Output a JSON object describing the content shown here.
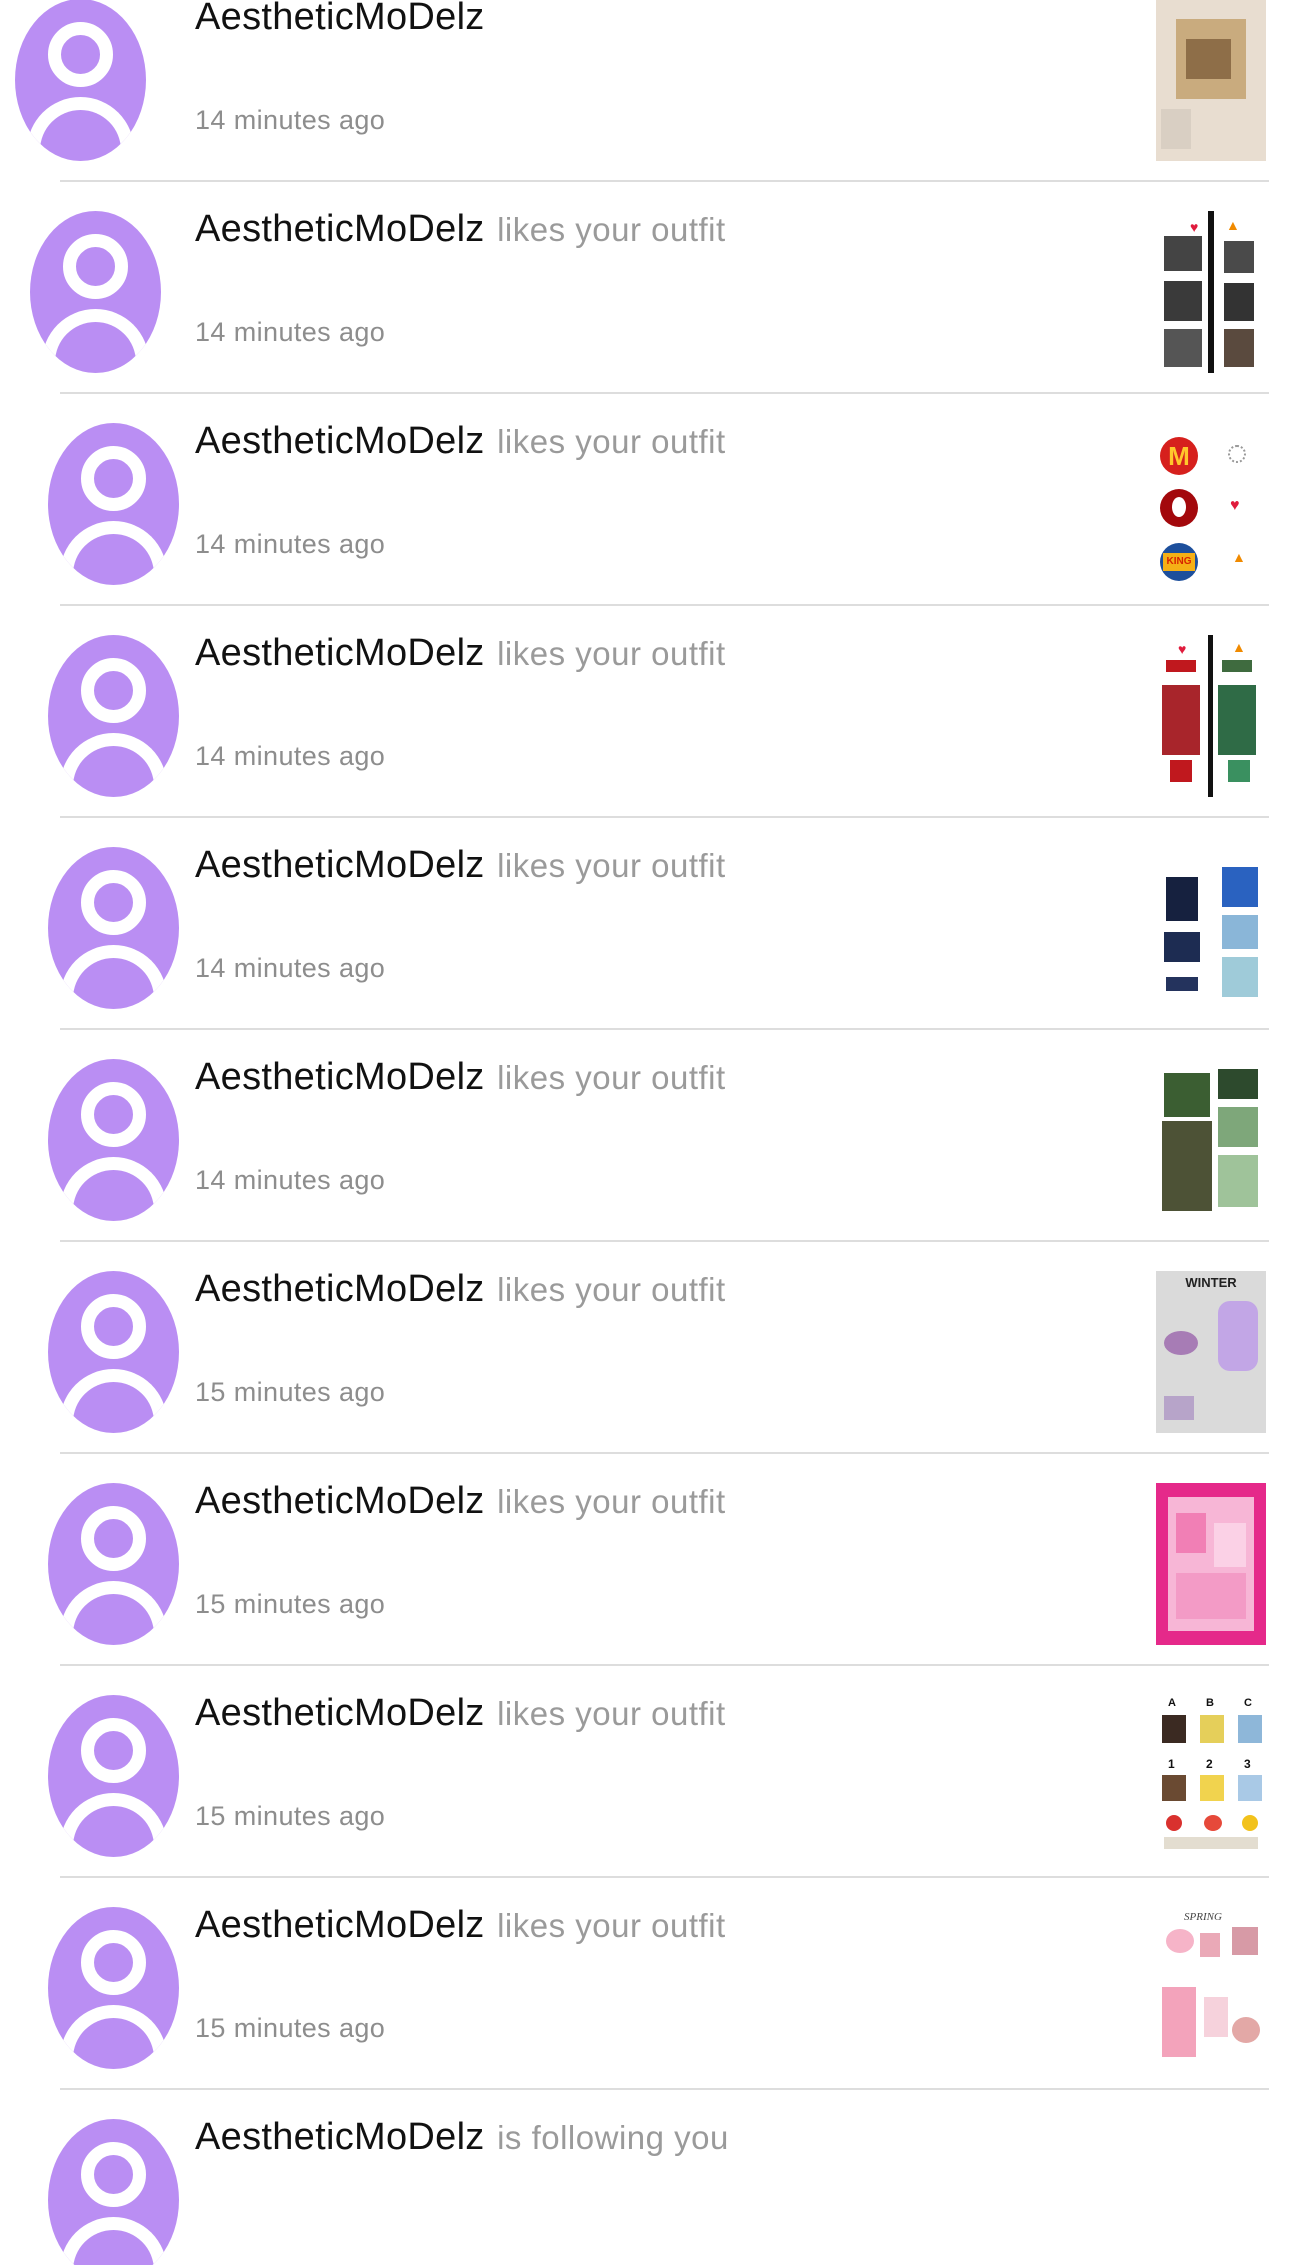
{
  "notifications": [
    {
      "user": "AestheticMoDelz",
      "action": "",
      "time": "14 minutes ago",
      "thumb": "collage-beige"
    },
    {
      "user": "AestheticMoDelz",
      "action": "likes your outfit",
      "time": "14 minutes ago",
      "thumb": "portraits-split"
    },
    {
      "user": "AestheticMoDelz",
      "action": "likes your outfit",
      "time": "14 minutes ago",
      "thumb": "fast-food-logos"
    },
    {
      "user": "AestheticMoDelz",
      "action": "likes your outfit",
      "time": "14 minutes ago",
      "thumb": "red-green-outfits"
    },
    {
      "user": "AestheticMoDelz",
      "action": "likes your outfit",
      "time": "14 minutes ago",
      "thumb": "navy-blue-outfit"
    },
    {
      "user": "AestheticMoDelz",
      "action": "likes your outfit",
      "time": "14 minutes ago",
      "thumb": "green-cargo-outfit"
    },
    {
      "user": "AestheticMoDelz",
      "action": "likes your outfit",
      "time": "15 minutes ago",
      "thumb": "winter-lilac"
    },
    {
      "user": "AestheticMoDelz",
      "action": "likes your outfit",
      "time": "15 minutes ago",
      "thumb": "pink-collage"
    },
    {
      "user": "AestheticMoDelz",
      "action": "likes your outfit",
      "time": "15 minutes ago",
      "thumb": "abc-123-choices"
    },
    {
      "user": "AestheticMoDelz",
      "action": "likes your outfit",
      "time": "15 minutes ago",
      "thumb": "spring-pink"
    },
    {
      "user": "AestheticMoDelz",
      "action": "is following you",
      "time": "",
      "thumb": ""
    }
  ],
  "thumb_text": {
    "winter": "WINTER",
    "spring": "SPRING",
    "abc": [
      "A",
      "B",
      "C"
    ],
    "nums": [
      "1",
      "2",
      "3"
    ],
    "logo_m": "M",
    "logo_bk": "KING"
  },
  "colors": {
    "avatar": "#ba8ef3",
    "username": "#111111",
    "action": "#9a9a9a",
    "time": "#8d8d8d",
    "divider": "#dddddd"
  }
}
